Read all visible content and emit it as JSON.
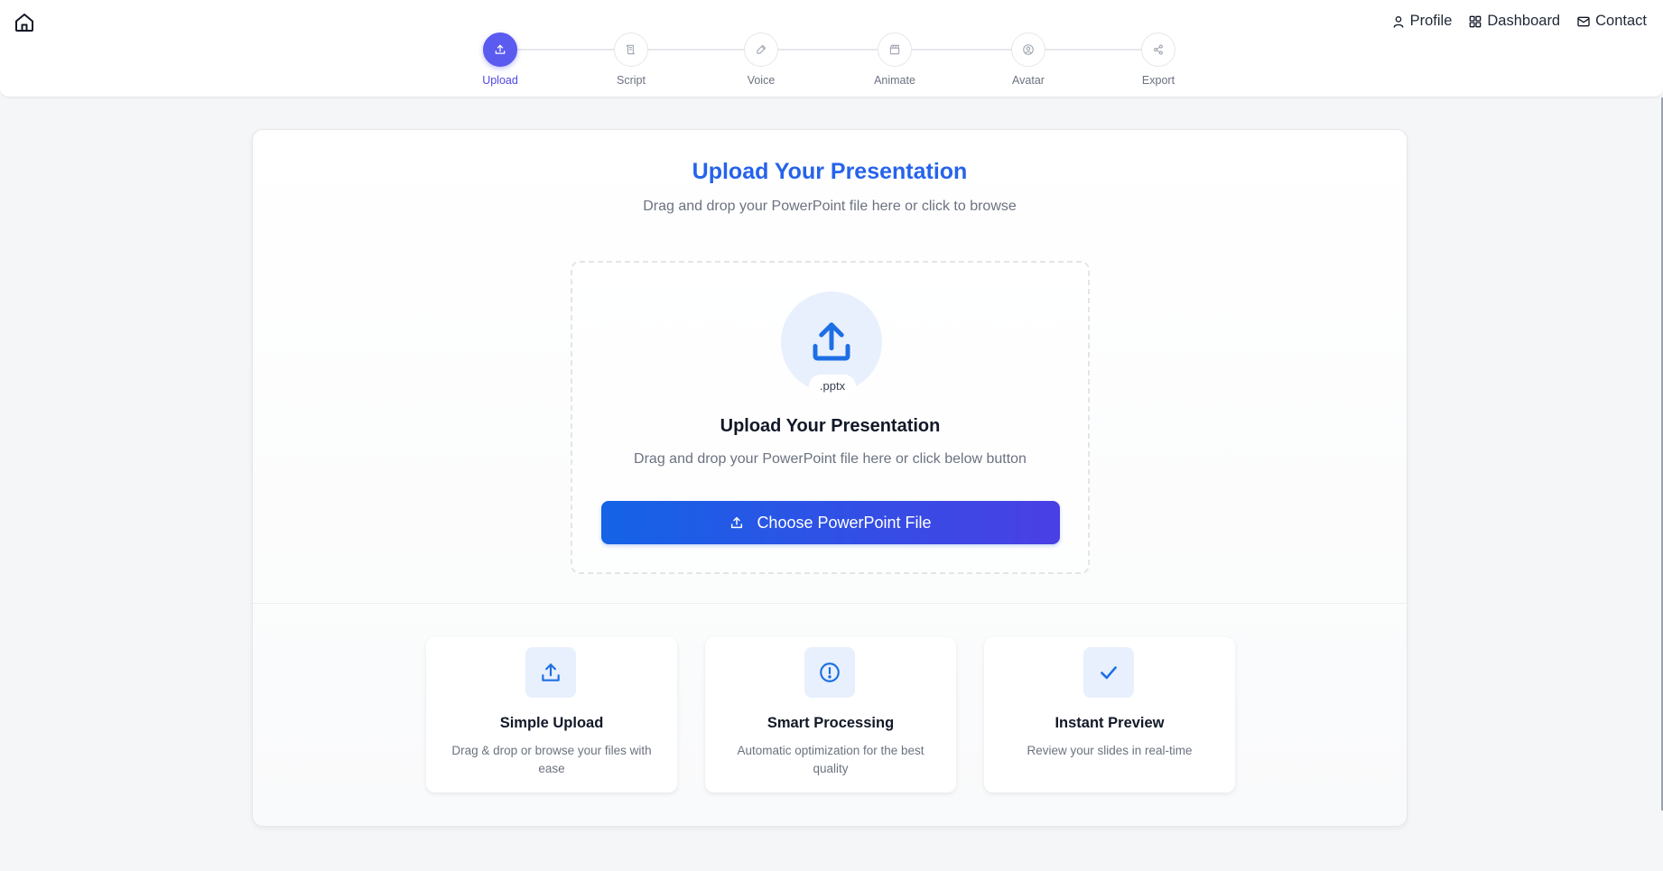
{
  "nav": {
    "home_icon": "home-icon",
    "links": [
      {
        "label": "Profile",
        "icon": "user-icon"
      },
      {
        "label": "Dashboard",
        "icon": "grid-icon"
      },
      {
        "label": "Contact",
        "icon": "mail-icon"
      }
    ]
  },
  "stepper": {
    "active_index": 0,
    "steps": [
      {
        "label": "Upload",
        "icon": "upload-icon"
      },
      {
        "label": "Script",
        "icon": "script-icon"
      },
      {
        "label": "Voice",
        "icon": "pen-icon"
      },
      {
        "label": "Animate",
        "icon": "clapperboard-icon"
      },
      {
        "label": "Avatar",
        "icon": "avatar-icon"
      },
      {
        "label": "Export",
        "icon": "share-icon"
      }
    ]
  },
  "main": {
    "title": "Upload Your Presentation",
    "subtitle": "Drag and drop your PowerPoint file here or click to browse",
    "dropzone": {
      "badge": ".pptx",
      "title": "Upload Your Presentation",
      "subtitle": "Drag and drop your PowerPoint file here or click below button",
      "button_label": "Choose PowerPoint File"
    },
    "features": [
      {
        "title": "Simple Upload",
        "desc": "Drag & drop or browse your files with ease",
        "icon": "upload-icon"
      },
      {
        "title": "Smart Processing",
        "desc": "Automatic optimization for the best quality",
        "icon": "alert-circle-icon"
      },
      {
        "title": "Instant Preview",
        "desc": "Review your slides in real-time",
        "icon": "check-icon"
      }
    ]
  },
  "colors": {
    "accent": "#2563eb",
    "active_step": "#5b5bf0",
    "button_start": "#1463e6",
    "button_end": "#4a3fe4"
  }
}
